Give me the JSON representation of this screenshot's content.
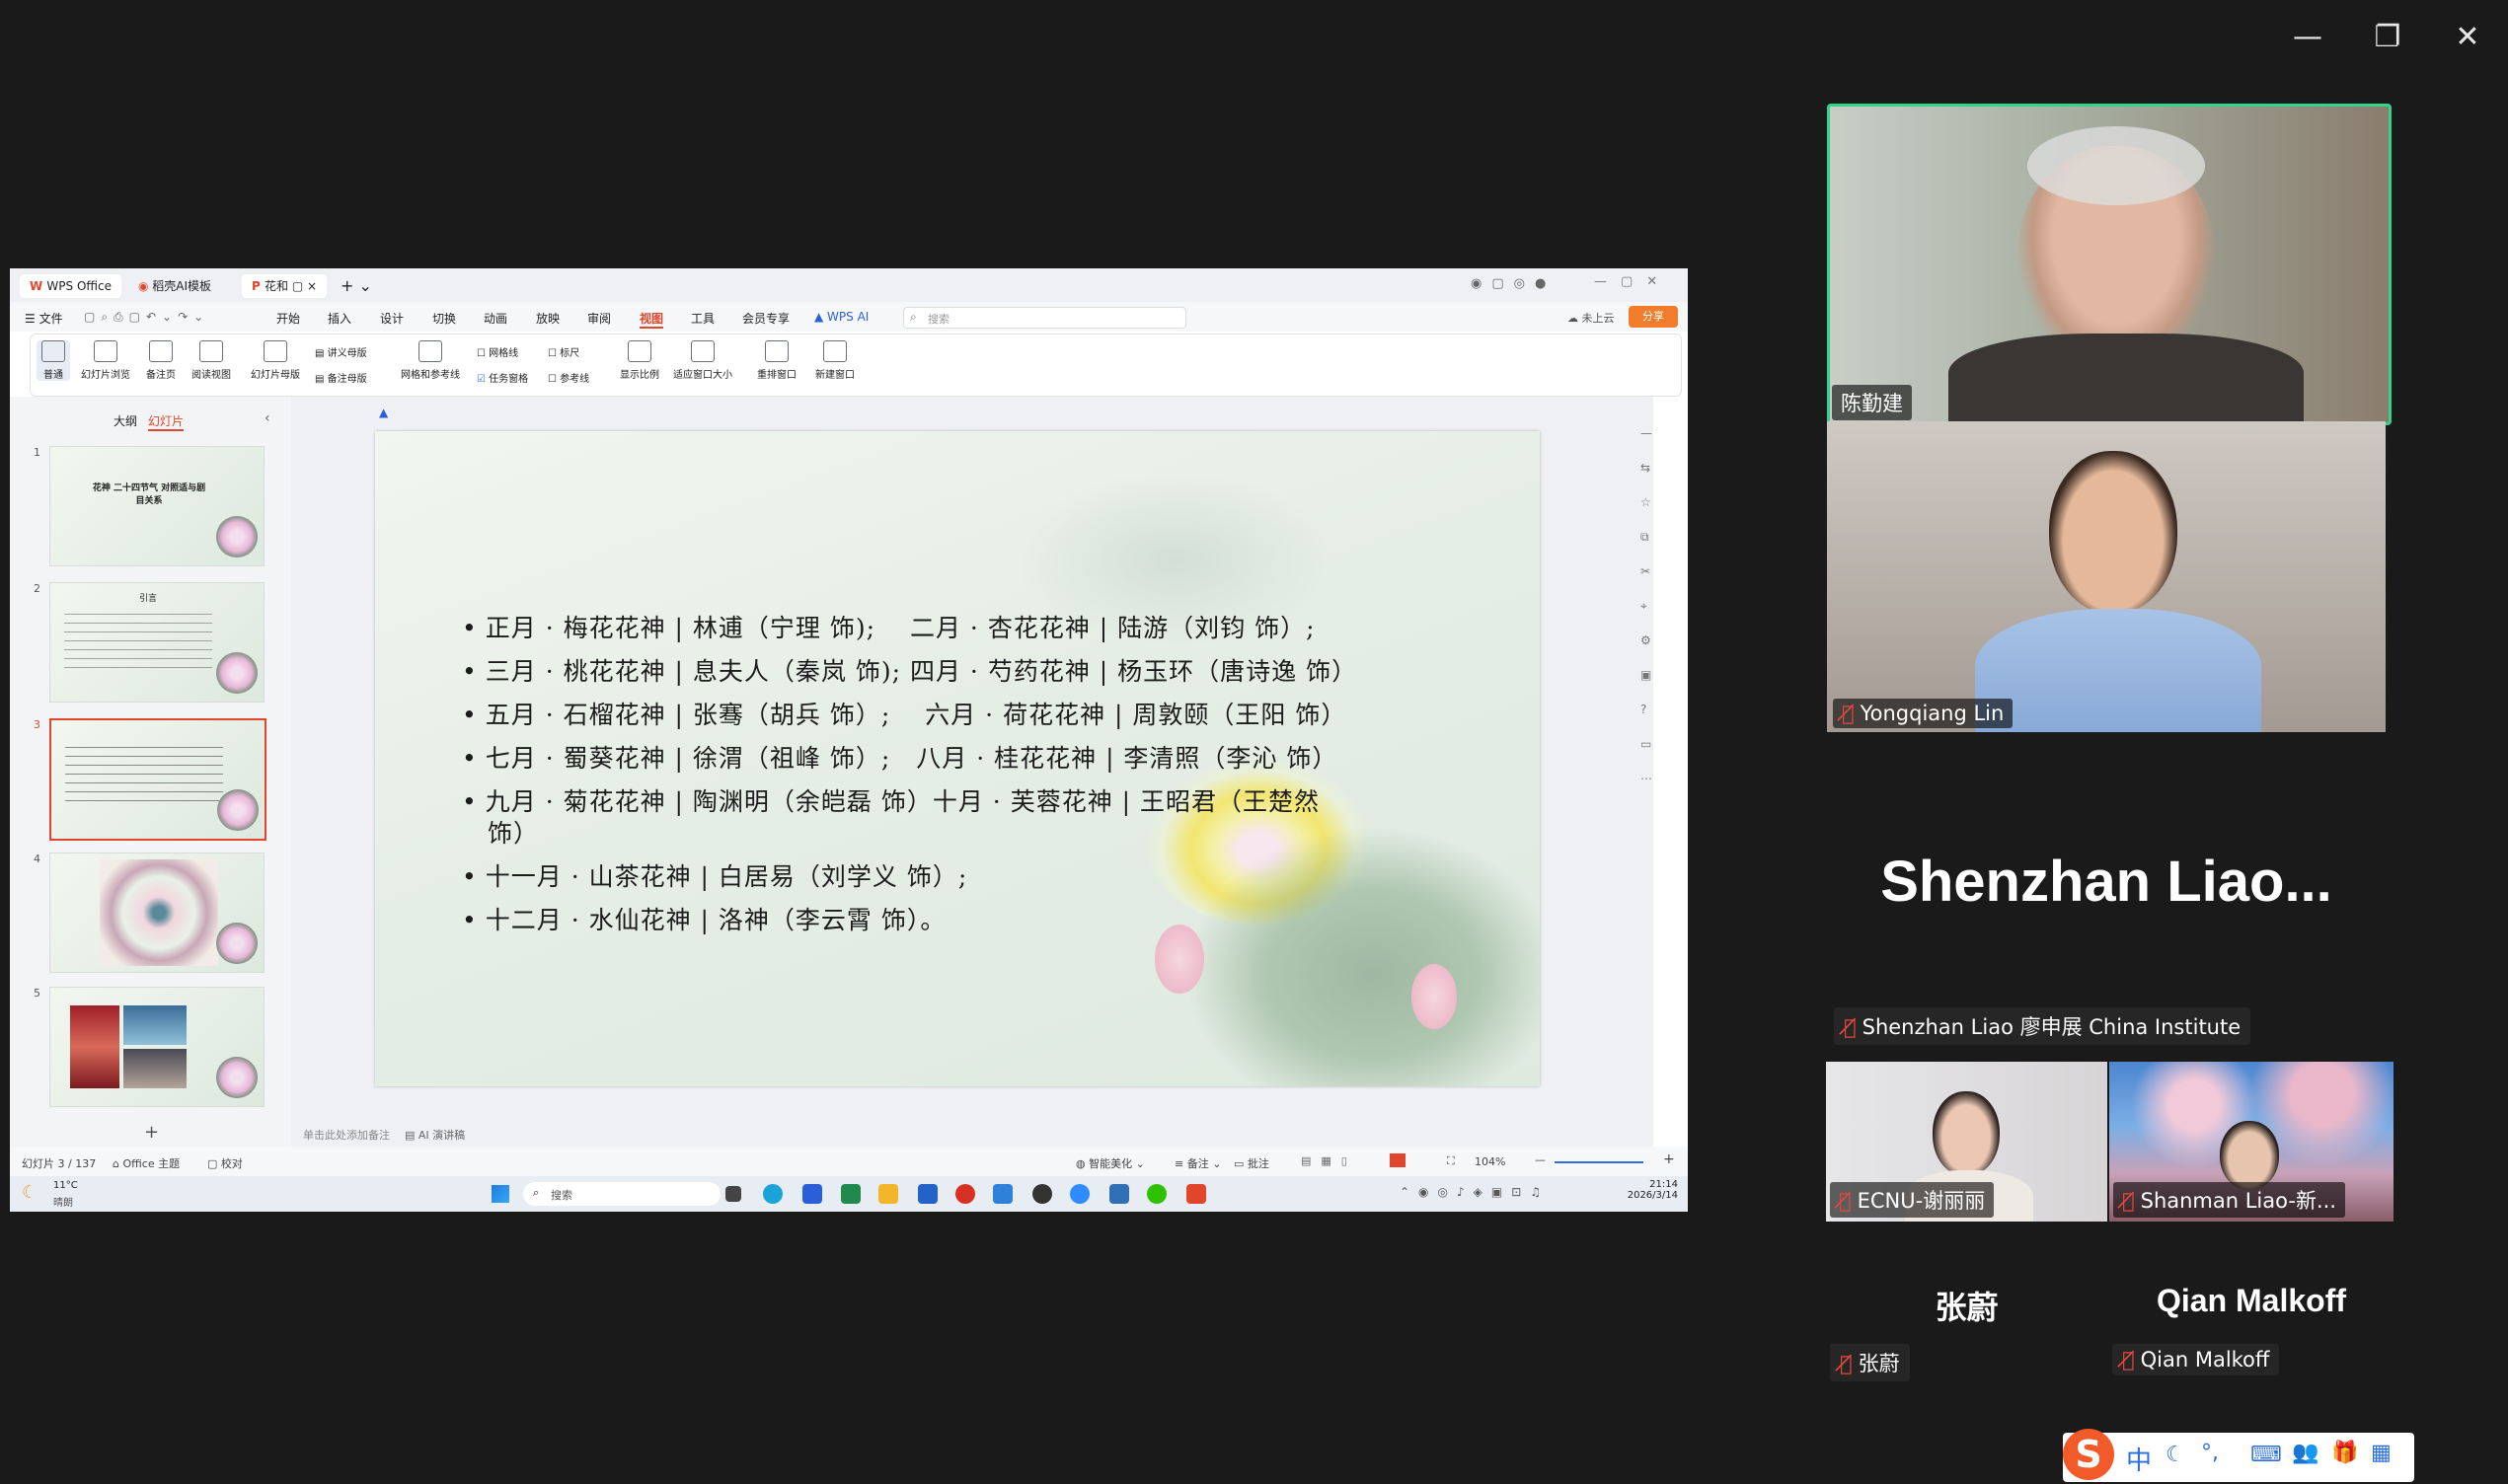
{
  "window_controls": {
    "minimize": "—",
    "restore": "❐",
    "close": "✕"
  },
  "wps": {
    "tabs": [
      "WPS Office",
      "稻壳AI模板",
      "花和"
    ],
    "menu": [
      "文件",
      "开始",
      "插入",
      "设计",
      "切换",
      "动画",
      "放映",
      "审阅",
      "视图",
      "工具",
      "会员专享",
      "WPS AI"
    ],
    "active_menu": "视图",
    "search_placeholder": "搜索",
    "cloud_label": "未上云",
    "share_label": "分享",
    "ribbon": {
      "normal": "普通",
      "slide_browse": "幻灯片浏览",
      "notes_page": "备注页",
      "reading_view": "阅读视图",
      "slide_master": "幻灯片母版",
      "handout_master": "讲义母版",
      "notes_master": "备注母版",
      "grid_guides": "网格和参考线",
      "gridlines": "网格线",
      "taskpane": "任务窗格",
      "ruler": "标尺",
      "guides": "参考线",
      "zoom": "显示比例",
      "fit": "适应窗口大小",
      "arrange": "重排窗口",
      "new_window": "新建窗口"
    },
    "panel_tabs": {
      "outline": "大纲",
      "slides": "幻灯片"
    },
    "thumbs": [
      {
        "n": "1",
        "title": "花神 二十四节气 对照适与剧目关系"
      },
      {
        "n": "2",
        "title": "引言"
      },
      {
        "n": "3",
        "title": ""
      },
      {
        "n": "4",
        "title": ""
      },
      {
        "n": "5",
        "title": ""
      }
    ],
    "add_slide": "+",
    "notes_hint": "单击此处添加备注",
    "ai_notes": "AI 演讲稿",
    "slide_lines": [
      "正月 · 梅花花神 | 林逋（宁理 饰);　 二月 · 杏花花神 | 陆游（刘钧 饰）;",
      "三月 · 桃花花神 | 息夫人（秦岚 饰); 四月 · 芍药花神 | 杨玉环（唐诗逸 饰）",
      "五月 · 石榴花神 | 张骞（胡兵 饰）;　 六月 · 荷花花神 | 周敦颐（王阳 饰）",
      "七月 · 蜀葵花神 | 徐渭（祖峰 饰）;　八月 · 桂花花神 | 李清照（李沁 饰）",
      "九月 · 菊花花神 | 陶渊明（余皑磊 饰）十月 · 芙蓉花神 | 王昭君（王楚然",
      "饰）",
      "十一月 · 山茶花神 | 白居易（刘学义 饰）;",
      "十二月 · 水仙花神 | 洛神（李云霄 饰）。"
    ],
    "status": {
      "slide_count": "幻灯片 3 / 137",
      "theme": "Office 主题",
      "proof": "校对",
      "beautify": "智能美化",
      "notes": "备注",
      "comments": "批注",
      "zoom": "104%"
    },
    "taskbar": {
      "weather_temp": "11°C",
      "weather_desc": "晴朗",
      "search": "搜索",
      "time": "21:14",
      "date": "2026/3/14"
    }
  },
  "participants": {
    "p1": "陈勤建",
    "p2": "Yongqiang Lin",
    "p3_big": "Shenzhan  Liao...",
    "p3_label": "Shenzhan Liao 廖申展 China Institute",
    "p4": "ECNU-谢丽丽",
    "p5": "Shanman Liao-新...",
    "p6_big": "张蔚",
    "p6_label": "张蔚",
    "p7_big": "Qian Malkoff",
    "p7_label": "Qian Malkoff"
  },
  "ime": {
    "lang": "中",
    "items": [
      "☾",
      "°,",
      "⌨",
      "👥",
      "🎁",
      "▦"
    ]
  },
  "colors": {
    "active_speaker": "#2fd58a",
    "wps_red": "#e1452c",
    "mute_red": "#e5483d"
  }
}
